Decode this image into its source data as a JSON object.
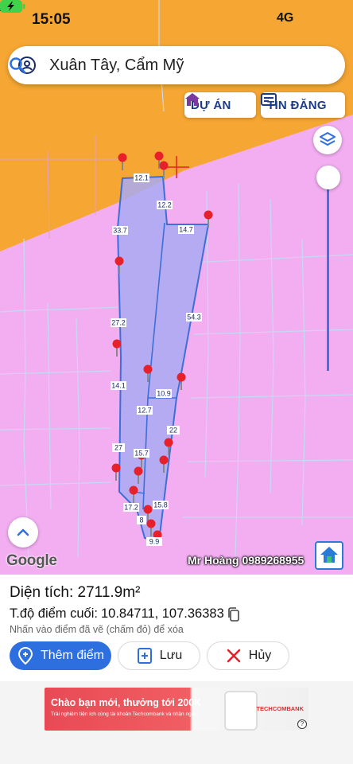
{
  "status": {
    "time": "15:05",
    "network": "4G"
  },
  "search": {
    "query": "Xuân Tây, Cẩm Mỹ"
  },
  "chips": {
    "du_an": "DỰ ÁN",
    "tin_dang": "TIN ĐĂNG"
  },
  "map": {
    "google_label": "Google",
    "owner_watermark": "Mr Hoàng 0989268955",
    "edge_labels": [
      "12.1",
      "12.2",
      "14.7",
      "33.7",
      "54.3",
      "27.2",
      "14.1",
      "10.9",
      "12.7",
      "22",
      "27",
      "15.7",
      "17.2",
      "15.8",
      "8",
      "9.9"
    ]
  },
  "panel": {
    "area_label": "Diện tích:",
    "area_value": "2711.9m²",
    "coords_label": "T.độ điểm cuối:",
    "coords_value": "10.84711, 107.36383",
    "hint": "Nhấn vào điểm đã vẽ (chấm đỏ) để xóa",
    "add_point": "Thêm điểm",
    "save": "Lưu",
    "cancel": "Hủy"
  },
  "ad": {
    "title": "Chào bạn mới, thưởng tới 200K",
    "subtitle": "Trải nghiệm tiện ích cùng tài khoản Techcombank và nhận ngay!",
    "brand": "TECHCOMBANK"
  },
  "colors": {
    "map_pink": "#f3aef2",
    "orange_zone": "#f5a633",
    "parcel_fill": "#a9aaf3",
    "accent_blue": "#2e6fe0",
    "marker_red": "#e8202a"
  }
}
